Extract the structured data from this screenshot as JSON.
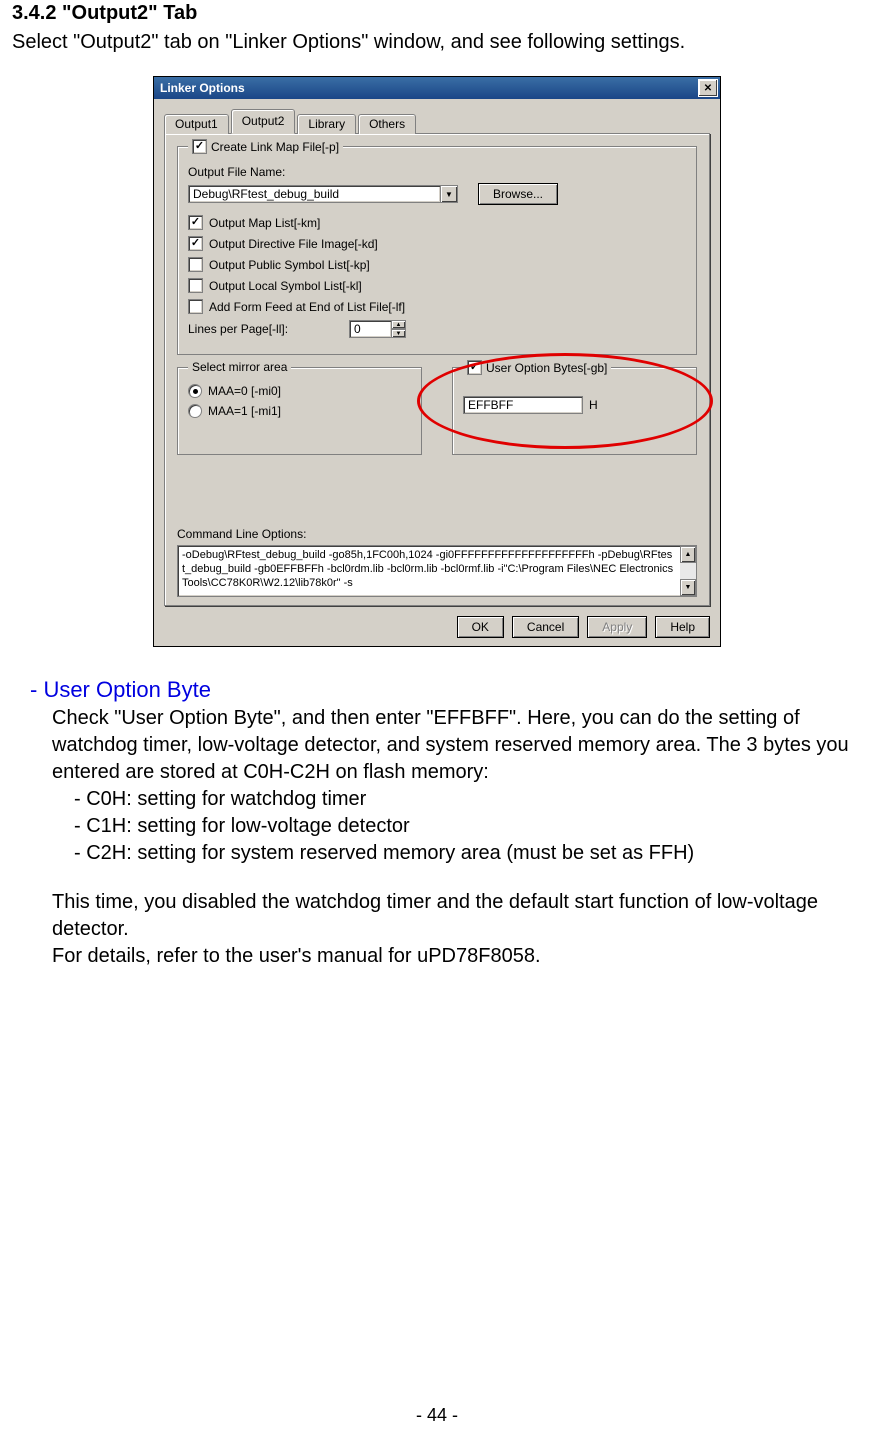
{
  "section_heading": "3.4.2 \"Output2\" Tab",
  "intro": "Select \"Output2\" tab on \"Linker Options\" window, and see following settings.",
  "dialog": {
    "title": "Linker Options",
    "tabs": [
      "Output1",
      "Output2",
      "Library",
      "Others"
    ],
    "active_tab": 1,
    "group_link_map": {
      "legend": "Create Link Map File[-p]",
      "checked": true,
      "output_file_label": "Output File Name:",
      "output_file_value": "Debug\\RFtest_debug_build",
      "browse": "Browse...",
      "opts": [
        {
          "label": "Output Map List[-km]",
          "checked": true
        },
        {
          "label": "Output Directive File Image[-kd]",
          "checked": true
        },
        {
          "label": "Output Public Symbol List[-kp]",
          "checked": false
        },
        {
          "label": "Output Local Symbol List[-kl]",
          "checked": false
        },
        {
          "label": "Add Form Feed at End of List File[-lf]",
          "checked": false
        }
      ],
      "lines_per_page_label": "Lines per Page[-ll]:",
      "lines_per_page_value": "0"
    },
    "mirror": {
      "legend": "Select mirror area",
      "opts": [
        {
          "label": "MAA=0 [-mi0]",
          "selected": true
        },
        {
          "label": "MAA=1 [-mi1]",
          "selected": false
        }
      ]
    },
    "user_option": {
      "legend": "User Option Bytes[-gb]",
      "checked": true,
      "value": "EFFBFF",
      "suffix": "H"
    },
    "cmdline_label": "Command Line Options:",
    "cmdline_value": "-oDebug\\RFtest_debug_build -go85h,1FC00h,1024 -gi0FFFFFFFFFFFFFFFFFFFFh -pDebug\\RFtest_debug_build -gb0EFFBFFh -bcl0rdm.lib -bcl0rm.lib -bcl0rmf.lib -i\"C:\\Program Files\\NEC Electronics Tools\\CC78K0R\\W2.12\\lib78k0r\" -s",
    "buttons": {
      "ok": "OK",
      "cancel": "Cancel",
      "apply": "Apply",
      "help": "Help"
    }
  },
  "explain": {
    "heading": "- User Option Byte",
    "p1": "Check \"User Option Byte\", and then enter \"EFFBFF\". Here, you can do the setting of watchdog timer, low-voltage detector, and system reserved memory area. The 3 bytes you entered are stored at C0H-C2H on flash memory:",
    "b1": "- C0H: setting for watchdog timer",
    "b2": "- C1H: setting for low-voltage detector",
    "b3": "- C2H: setting for system reserved memory area (must be set as FFH)",
    "p2": "This time, you disabled the watchdog timer and the default start function of low-voltage detector.",
    "p3": "For details, refer to the user's manual for uPD78F8058."
  },
  "page_number": "- 44 -"
}
